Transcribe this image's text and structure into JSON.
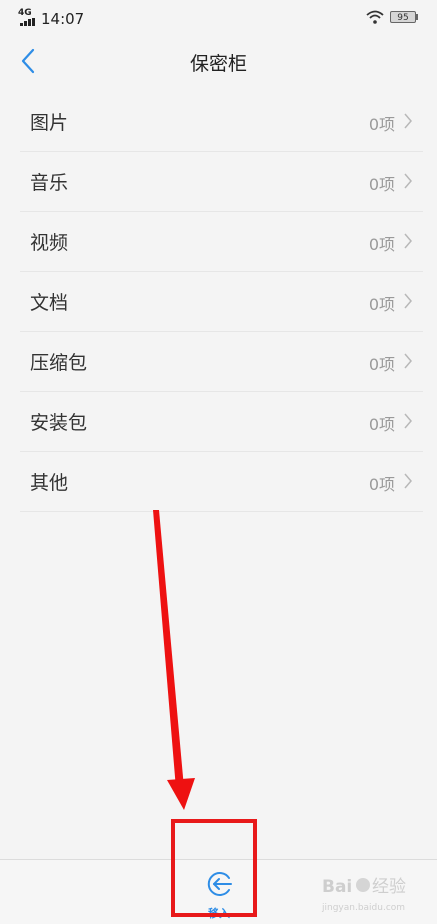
{
  "status_bar": {
    "network": "4G",
    "time": "14:07",
    "battery": "95"
  },
  "header": {
    "title": "保密柜",
    "back_icon": "chevron-left-icon"
  },
  "categories": [
    {
      "label": "图片",
      "count": "0项"
    },
    {
      "label": "音乐",
      "count": "0项"
    },
    {
      "label": "视频",
      "count": "0项"
    },
    {
      "label": "文档",
      "count": "0项"
    },
    {
      "label": "压缩包",
      "count": "0项"
    },
    {
      "label": "安装包",
      "count": "0项"
    },
    {
      "label": "其他",
      "count": "0项"
    }
  ],
  "bottom_bar": {
    "move_in_label": "移入",
    "move_in_icon": "arrow-in-circle-icon"
  },
  "colors": {
    "accent": "#2e8de6",
    "annotation": "#e8191a"
  },
  "watermark": {
    "text": "Bai du 经验",
    "sub": "jingyan.baidu.com"
  }
}
